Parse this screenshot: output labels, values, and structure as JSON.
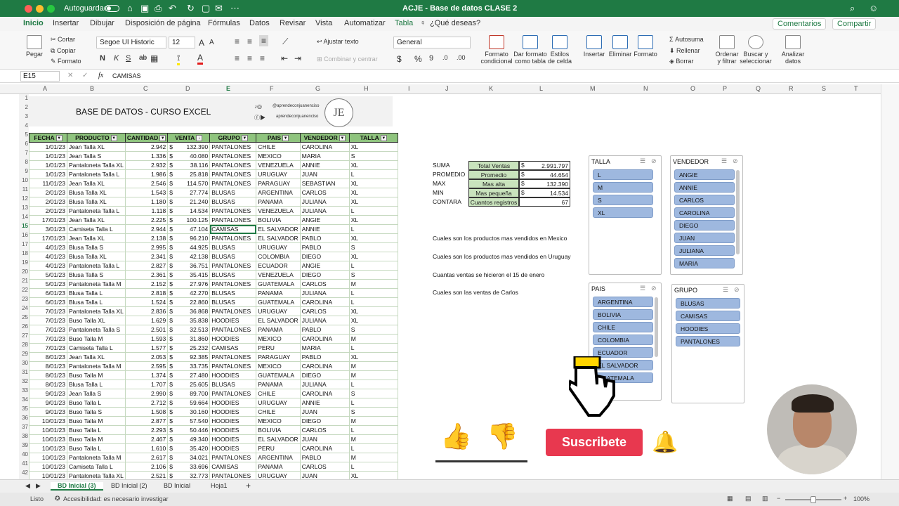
{
  "titlebar": {
    "autosave": "Autoguardado",
    "title": "ACJE - Base de datos CLASE 2",
    "dot_colors": [
      "#ff5f57",
      "#febc2e",
      "#28c840"
    ]
  },
  "ribbon_tabs": [
    "Inicio",
    "Insertar",
    "Dibujar",
    "Disposición de página",
    "Fórmulas",
    "Datos",
    "Revisar",
    "Vista",
    "Automatizar",
    "Tabla"
  ],
  "ribbon_search": "¿Qué deseas?",
  "ribbon_right": {
    "comments": "Comentarios",
    "share": "Compartir"
  },
  "ribbon": {
    "paste": "Pegar",
    "cut": "Cortar",
    "copy": "Copiar",
    "format": "Formato",
    "font": "Segoe UI Historic",
    "size": "12",
    "bold": "N",
    "italic": "K",
    "underline": "S",
    "strike": "ab",
    "wrap": "Ajustar texto",
    "merge": "Combinar y centrar",
    "number_format": "General",
    "cond_format": "Formato condicional",
    "as_table": "Dar formato como tabla",
    "cell_styles": "Estilos de celda",
    "insert": "Insertar",
    "delete": "Eliminar",
    "format2": "Formato",
    "autosum": "Autosuma",
    "fill": "Rellenar",
    "clear": "Borrar",
    "sort": "Ordenar y filtrar",
    "find": "Buscar y seleccionar",
    "analyze": "Analizar datos",
    "currency": "$",
    "percent": "%",
    "comma": "9"
  },
  "formula_bar": {
    "name_box": "E15",
    "fx": "fx",
    "content": "CAMISAS"
  },
  "columns": [
    "A",
    "B",
    "C",
    "D",
    "E",
    "F",
    "G",
    "H",
    "I",
    "J",
    "K",
    "L",
    "M",
    "N",
    "O",
    "P",
    "Q",
    "R",
    "S",
    "T"
  ],
  "rows": [
    "1",
    "2",
    "3",
    "4",
    "5",
    "6",
    "7",
    "8",
    "9",
    "10",
    "11",
    "12",
    "13",
    "14",
    "15",
    "16",
    "17",
    "18",
    "19",
    "20",
    "21",
    "22",
    "23",
    "24",
    "25",
    "26",
    "27",
    "28",
    "29",
    "30",
    "31",
    "32",
    "33",
    "34",
    "35",
    "36",
    "37",
    "38",
    "39",
    "40",
    "41",
    "42"
  ],
  "banner": {
    "title": "BASE DE DATOS - CURSO EXCEL",
    "handle1": "@aprendeconjuanenciso",
    "handle2": "aprendeconjuanenciso",
    "logo": "JE"
  },
  "table": {
    "headers": [
      "FECHA",
      "PRODUCTO",
      "CANTIDAD",
      "VENTA",
      "GRUPO",
      "PAIS",
      "VENDEDOR",
      "TALLA"
    ],
    "rows": [
      [
        "1/01/23",
        "Jean Talla XL",
        "2.942",
        "$",
        "132.390",
        "PANTALONES",
        "CHILE",
        "CAROLINA",
        "XL"
      ],
      [
        "1/01/23",
        "Jean Talla S",
        "1.336",
        "$",
        "40.080",
        "PANTALONES",
        "MEXICO",
        "MARIA",
        "S"
      ],
      [
        "1/01/23",
        "Pantaloneta Talla XL",
        "2.932",
        "$",
        "38.116",
        "PANTALONES",
        "VENEZUELA",
        "ANNIE",
        "XL"
      ],
      [
        "1/01/23",
        "Pantaloneta Talla L",
        "1.986",
        "$",
        "25.818",
        "PANTALONES",
        "URUGUAY",
        "JUAN",
        "L"
      ],
      [
        "11/01/23",
        "Jean Talla XL",
        "2.546",
        "$",
        "114.570",
        "PANTALONES",
        "PARAGUAY",
        "SEBASTIAN",
        "XL"
      ],
      [
        "2/01/23",
        "Blusa Talla XL",
        "1.543",
        "$",
        "27.774",
        "BLUSAS",
        "ARGENTINA",
        "CARLOS",
        "XL"
      ],
      [
        "2/01/23",
        "Blusa Talla XL",
        "1.180",
        "$",
        "21.240",
        "BLUSAS",
        "PANAMA",
        "JULIANA",
        "XL"
      ],
      [
        "2/01/23",
        "Pantaloneta Talla L",
        "1.118",
        "$",
        "14.534",
        "PANTALONES",
        "VENEZUELA",
        "JULIANA",
        "L"
      ],
      [
        "17/01/23",
        "Jean Talla XL",
        "2.225",
        "$",
        "100.125",
        "PANTALONES",
        "BOLIVIA",
        "ANGIE",
        "XL"
      ],
      [
        "3/01/23",
        "Camiseta Talla L",
        "2.944",
        "$",
        "47.104",
        "CAMISAS",
        "EL SALVADOR",
        "ANNIE",
        "L"
      ],
      [
        "17/01/23",
        "Jean Talla XL",
        "2.138",
        "$",
        "96.210",
        "PANTALONES",
        "EL SALVADOR",
        "PABLO",
        "XL"
      ],
      [
        "4/01/23",
        "Blusa Talla S",
        "2.995",
        "$",
        "44.925",
        "BLUSAS",
        "URUGUAY",
        "PABLO",
        "S"
      ],
      [
        "4/01/23",
        "Blusa Talla XL",
        "2.341",
        "$",
        "42.138",
        "BLUSAS",
        "COLOMBIA",
        "DIEGO",
        "XL"
      ],
      [
        "4/01/23",
        "Pantaloneta Talla L",
        "2.827",
        "$",
        "36.751",
        "PANTALONES",
        "ECUADOR",
        "ANGIE",
        "L"
      ],
      [
        "5/01/23",
        "Blusa Talla S",
        "2.361",
        "$",
        "35.415",
        "BLUSAS",
        "VENEZUELA",
        "DIEGO",
        "S"
      ],
      [
        "5/01/23",
        "Pantaloneta Talla M",
        "2.152",
        "$",
        "27.976",
        "PANTALONES",
        "GUATEMALA",
        "CARLOS",
        "M"
      ],
      [
        "6/01/23",
        "Blusa Talla L",
        "2.818",
        "$",
        "42.270",
        "BLUSAS",
        "PANAMA",
        "JULIANA",
        "L"
      ],
      [
        "6/01/23",
        "Blusa Talla L",
        "1.524",
        "$",
        "22.860",
        "BLUSAS",
        "GUATEMALA",
        "CAROLINA",
        "L"
      ],
      [
        "7/01/23",
        "Pantaloneta Talla XL",
        "2.836",
        "$",
        "36.868",
        "PANTALONES",
        "URUGUAY",
        "CARLOS",
        "XL"
      ],
      [
        "7/01/23",
        "Buso Talla XL",
        "1.629",
        "$",
        "35.838",
        "HOODIES",
        "EL SALVADOR",
        "JULIANA",
        "XL"
      ],
      [
        "7/01/23",
        "Pantaloneta Talla S",
        "2.501",
        "$",
        "32.513",
        "PANTALONES",
        "PANAMA",
        "PABLO",
        "S"
      ],
      [
        "7/01/23",
        "Buso Talla M",
        "1.593",
        "$",
        "31.860",
        "HOODIES",
        "MEXICO",
        "CAROLINA",
        "M"
      ],
      [
        "7/01/23",
        "Camiseta Talla L",
        "1.577",
        "$",
        "25.232",
        "CAMISAS",
        "PERU",
        "MARIA",
        "L"
      ],
      [
        "8/01/23",
        "Jean Talla XL",
        "2.053",
        "$",
        "92.385",
        "PANTALONES",
        "PARAGUAY",
        "PABLO",
        "XL"
      ],
      [
        "8/01/23",
        "Pantaloneta Talla M",
        "2.595",
        "$",
        "33.735",
        "PANTALONES",
        "MEXICO",
        "CAROLINA",
        "M"
      ],
      [
        "8/01/23",
        "Buso Talla M",
        "1.374",
        "$",
        "27.480",
        "HOODIES",
        "GUATEMALA",
        "DIEGO",
        "M"
      ],
      [
        "8/01/23",
        "Blusa Talla L",
        "1.707",
        "$",
        "25.605",
        "BLUSAS",
        "PANAMA",
        "JULIANA",
        "L"
      ],
      [
        "9/01/23",
        "Jean Talla S",
        "2.990",
        "$",
        "89.700",
        "PANTALONES",
        "CHILE",
        "CAROLINA",
        "S"
      ],
      [
        "9/01/23",
        "Buso Talla L",
        "2.712",
        "$",
        "59.664",
        "HOODIES",
        "URUGUAY",
        "ANNIE",
        "L"
      ],
      [
        "9/01/23",
        "Buso Talla S",
        "1.508",
        "$",
        "30.160",
        "HOODIES",
        "CHILE",
        "JUAN",
        "S"
      ],
      [
        "10/01/23",
        "Buso Talla M",
        "2.877",
        "$",
        "57.540",
        "HOODIES",
        "MEXICO",
        "DIEGO",
        "M"
      ],
      [
        "10/01/23",
        "Buso Talla L",
        "2.293",
        "$",
        "50.446",
        "HOODIES",
        "BOLIVIA",
        "CARLOS",
        "L"
      ],
      [
        "10/01/23",
        "Buso Talla M",
        "2.467",
        "$",
        "49.340",
        "HOODIES",
        "EL SALVADOR",
        "JUAN",
        "M"
      ],
      [
        "10/01/23",
        "Buso Talla L",
        "1.610",
        "$",
        "35.420",
        "HOODIES",
        "PERU",
        "CAROLINA",
        "L"
      ],
      [
        "10/01/23",
        "Pantaloneta Talla M",
        "2.617",
        "$",
        "34.021",
        "PANTALONES",
        "ARGENTINA",
        "PABLO",
        "M"
      ],
      [
        "10/01/23",
        "Camiseta Talla L",
        "2.106",
        "$",
        "33.696",
        "CAMISAS",
        "PANAMA",
        "CARLOS",
        "L"
      ],
      [
        "10/01/23",
        "Pantaloneta Talla XL",
        "2.521",
        "$",
        "32.773",
        "PANTALONES",
        "URUGUAY",
        "JUAN",
        "XL"
      ]
    ]
  },
  "stats": {
    "labels": [
      "SUMA",
      "PROMEDIO",
      "MAX",
      "MIN",
      "CONTARA"
    ],
    "names": [
      "Total Ventas",
      "Promedio",
      "Mas alta",
      "Mas pequeña",
      "Cuantos registros"
    ],
    "currency": [
      "$",
      "$",
      "$",
      "$",
      ""
    ],
    "values": [
      "2.991.797",
      "44.654",
      "132.390",
      "14.534",
      "67"
    ]
  },
  "questions": [
    "Cuales son los productos mas vendidos en Mexico",
    "Cuales son los productos mas vendidos en Uruguay",
    "Cuantas ventas se hicieron el 15 de enero",
    "Cuales son las ventas de Carlos"
  ],
  "slicers": {
    "talla": {
      "title": "TALLA",
      "items": [
        "L",
        "M",
        "S",
        "XL"
      ]
    },
    "vendedor": {
      "title": "VENDEDOR",
      "items": [
        "ANGIE",
        "ANNIE",
        "CARLOS",
        "CAROLINA",
        "DIEGO",
        "JUAN",
        "JULIANA",
        "MARIA"
      ]
    },
    "pais": {
      "title": "PAIS",
      "items": [
        "ARGENTINA",
        "BOLIVIA",
        "CHILE",
        "COLOMBIA",
        "ECUADOR",
        "EL SALVADOR",
        "GUATEMALA"
      ]
    },
    "grupo": {
      "title": "GRUPO",
      "items": [
        "BLUSAS",
        "CAMISAS",
        "HOODIES",
        "PANTALONES"
      ]
    }
  },
  "sheet_tabs": [
    "BD Inicial (3)",
    "BD Inicial (2)",
    "BD Inicial",
    "Hoja1"
  ],
  "status": {
    "ready": "Listo",
    "accessibility": "Accesibilidad: es necesario investigar",
    "zoom": "100%"
  },
  "overlay": {
    "subscribe": "Suscribete"
  },
  "colors": {
    "excel_green": "#1f7a44",
    "header_green": "#8fc47e",
    "slicer_blue": "#9eb8df",
    "subscribe_red": "#e8384f"
  }
}
